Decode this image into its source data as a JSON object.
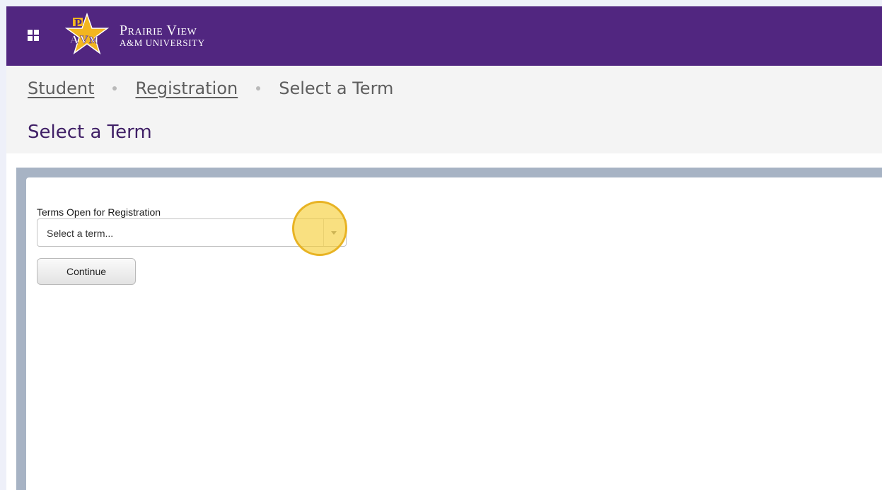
{
  "header": {
    "menu_icon": "grid-icon",
    "logo_monogram": "PVAM",
    "logo_line1": "Prairie View",
    "logo_line2": "A&M University",
    "background_color": "#512680"
  },
  "breadcrumb": {
    "items": [
      {
        "label": "Student"
      },
      {
        "label": "Registration"
      },
      {
        "label": "Select a Term"
      }
    ]
  },
  "page_title": "Select a Term",
  "form": {
    "label": "Terms Open for Registration",
    "select_value": "Select a term...",
    "select_icon": "chevron-down-icon",
    "continue_label": "Continue"
  }
}
